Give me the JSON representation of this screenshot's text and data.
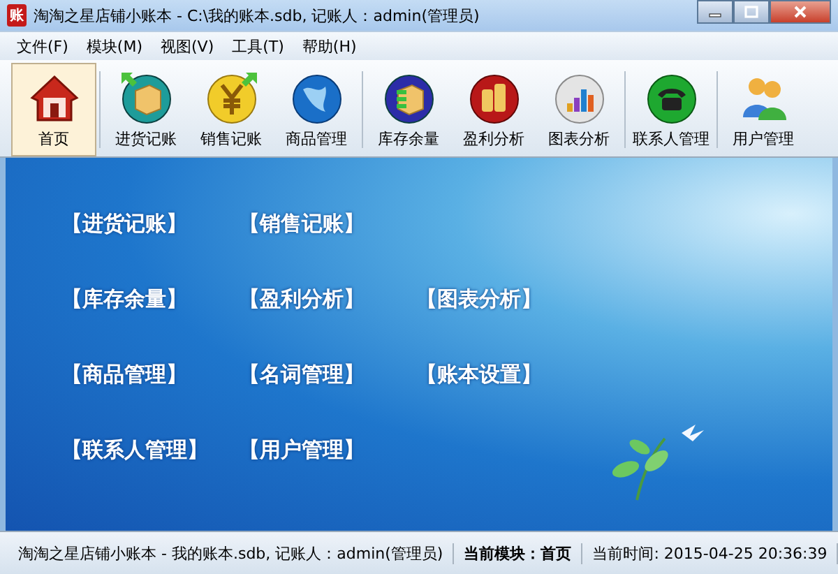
{
  "window": {
    "title": "淘淘之星店铺小账本 - C:\\我的账本.sdb,  记账人：admin(管理员)",
    "app_badge": "账"
  },
  "menu": [
    "文件(F)",
    "模块(M)",
    "视图(V)",
    "工具(T)",
    "帮助(H)"
  ],
  "toolbar": {
    "groups": [
      [
        {
          "label": "首页",
          "selected": true
        }
      ],
      [
        {
          "label": "进货记账",
          "selected": false
        },
        {
          "label": "销售记账",
          "selected": false
        },
        {
          "label": "商品管理",
          "selected": false
        }
      ],
      [
        {
          "label": "库存余量",
          "selected": false
        },
        {
          "label": "盈利分析",
          "selected": false
        },
        {
          "label": "图表分析",
          "selected": false
        }
      ],
      [
        {
          "label": "联系人管理",
          "selected": false
        }
      ],
      [
        {
          "label": "用户管理",
          "selected": false
        }
      ]
    ]
  },
  "links": [
    [
      "【进货记账】",
      "【销售记账】"
    ],
    [
      "【库存余量】",
      "【盈利分析】",
      "【图表分析】"
    ],
    [
      "【商品管理】",
      "【名词管理】",
      "【账本设置】"
    ],
    [
      "【联系人管理】",
      "【用户管理】"
    ]
  ],
  "status_bar": {
    "info": "淘淘之星店铺小账本 - 我的账本.sdb,  记账人：admin(管理员)",
    "module": "当前模块：首页",
    "time": "当前时间: 2015-04-25 20:36:39"
  }
}
